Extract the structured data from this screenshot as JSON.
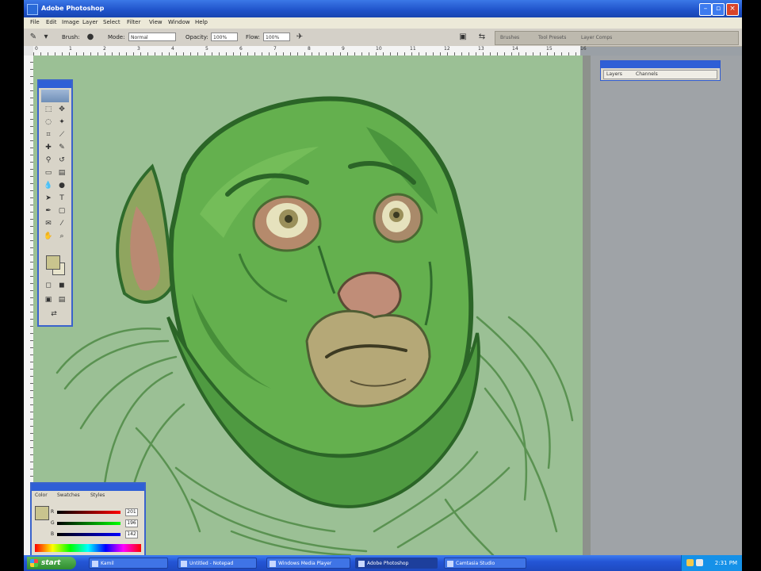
{
  "window": {
    "title": "Adobe Photoshop"
  },
  "menu": [
    "File",
    "Edit",
    "Image",
    "Layer",
    "Select",
    "Filter",
    "View",
    "Window",
    "Help"
  ],
  "options": {
    "brush_label": "Brush:",
    "mode_label": "Mode:",
    "mode_value": "Normal",
    "opacity_label": "Opacity:",
    "opacity_value": "100%",
    "flow_label": "Flow:",
    "flow_value": "100%",
    "palette_well_tabs": [
      "Brushes",
      "Tool Presets",
      "Layer Comps"
    ]
  },
  "ruler_marks": [
    "0",
    "1",
    "2",
    "3",
    "4",
    "5",
    "6",
    "7",
    "8",
    "9",
    "10",
    "11",
    "12",
    "13",
    "14",
    "15",
    "16"
  ],
  "layers_palette": {
    "tabs": [
      "Layers",
      "Channels"
    ]
  },
  "color_palette": {
    "tabs": [
      "Color",
      "Swatches",
      "Styles"
    ],
    "sliders": [
      {
        "label": "R",
        "value": "201",
        "gradient": "linear-gradient(90deg,#000,#f00)"
      },
      {
        "label": "G",
        "value": "196",
        "gradient": "linear-gradient(90deg,#000,#0f0)"
      },
      {
        "label": "B",
        "value": "142",
        "gradient": "linear-gradient(90deg,#000,#00f)"
      }
    ],
    "foreground": "#c9c48e"
  },
  "taskbar": {
    "start_label": "start",
    "tasks": [
      "Kamil",
      "Untitled - Notepad",
      "Windows Media Player",
      "Adobe Photoshop",
      "Camtasia Studio"
    ],
    "active_task": 3,
    "clock": "2:31 PM"
  },
  "colors": {
    "canvas": "#9bc095",
    "skin": "#5fa84a",
    "skin_dark": "#2f6b2c",
    "titlebar": "#1f52c9",
    "start": "#2f8d2f"
  }
}
